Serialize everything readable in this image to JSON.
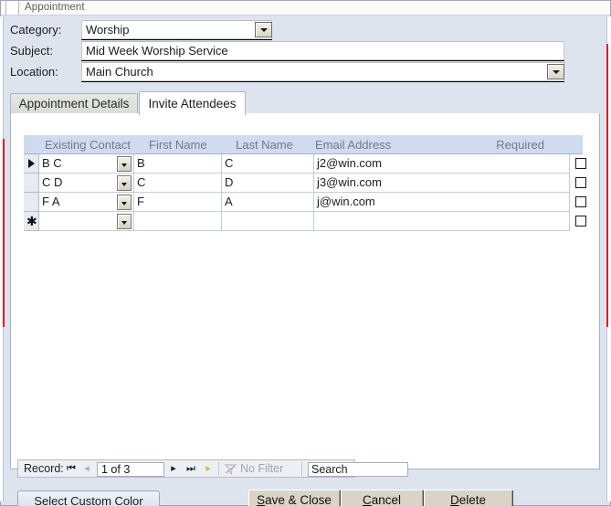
{
  "window": {
    "title": "Appointment"
  },
  "header_fields": [
    {
      "label": "Category:",
      "value": "Worship",
      "type": "combo"
    },
    {
      "label": "Subject:",
      "value": "Mid Week Worship Service",
      "type": "text"
    },
    {
      "label": "Location:",
      "value": "Main Church",
      "type": "combo"
    }
  ],
  "tabs": [
    {
      "label": "Appointment Details",
      "active": false
    },
    {
      "label": "Invite Attendees",
      "active": true
    }
  ],
  "datasheet": {
    "columns": [
      "Existing Contact",
      "First Name",
      "Last Name",
      "Email Address",
      "Required"
    ],
    "rows": [
      {
        "selector": "current-record-arrow",
        "existing_contact": "B C",
        "first_name": "B",
        "last_name": "C",
        "email": "j2@win.com",
        "required": false
      },
      {
        "selector": "",
        "existing_contact": "C D",
        "first_name": "C",
        "last_name": "D",
        "email": "j3@win.com",
        "required": false
      },
      {
        "selector": "",
        "existing_contact": "F A",
        "first_name": "F",
        "last_name": "A",
        "email": "j@win.com",
        "required": false
      },
      {
        "selector": "new-record-asterisk",
        "existing_contact": "",
        "first_name": "",
        "last_name": "",
        "email": "",
        "required": false
      }
    ]
  },
  "navigator": {
    "record_label": "Record:",
    "first_icon": "⏮",
    "prev_icon": "◂",
    "position": "1 of 3",
    "next_icon": "▸",
    "last_icon": "⏭",
    "new_icon": "▸",
    "filter_icon": "filter-icon",
    "filter_label": "No Filter",
    "search_placeholder": "Search",
    "search_value": "Search"
  },
  "footer": {
    "custom_color_label": "Select Custom Color",
    "save_close_label": "Save & Close",
    "save_close_accel": "S",
    "cancel_label": "Cancel",
    "cancel_accel": "C",
    "delete_label": "Delete",
    "delete_accel": "D"
  },
  "colors": {
    "window_back": "#dde4ee",
    "tab_page": "#ffffff",
    "header_band": "#cfdcef",
    "header_text": "#6e7b8c",
    "red_indicator": "#ee1111",
    "classic_button": "#d9d4c6"
  }
}
